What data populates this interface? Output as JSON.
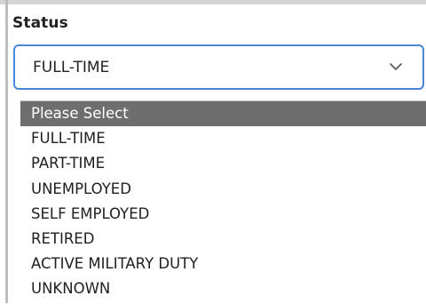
{
  "field": {
    "label": "Status",
    "selected_value": "FULL-TIME",
    "chevron_icon": "chevron-down-icon"
  },
  "dropdown": {
    "highlighted_index": 0,
    "options": [
      "Please Select",
      "FULL-TIME",
      "PART-TIME",
      "UNEMPLOYED",
      "SELF EMPLOYED",
      "RETIRED",
      "ACTIVE MILITARY DUTY",
      "UNKNOWN"
    ]
  },
  "colors": {
    "focus_border": "#4a86d8",
    "highlight_bg": "#6e6e6e"
  }
}
